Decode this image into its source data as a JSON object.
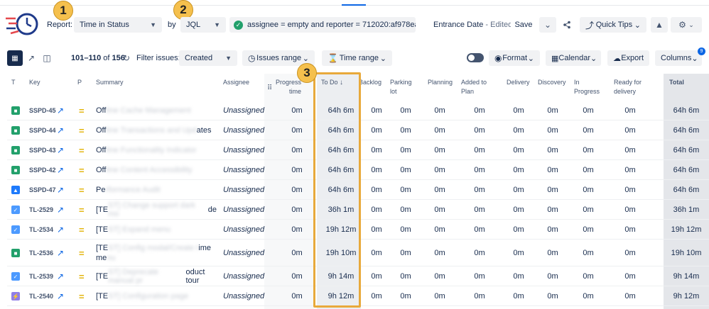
{
  "report_label": "Report:",
  "report_type": "Time in Status",
  "by_label": "by",
  "by_value": "JQL",
  "jql_query": "assignee = empty and reporter = 712020:af978ea3-8...",
  "entrance_date_title": "Entrance Date",
  "entrance_date_suffix": " - Edited",
  "save_label": "Save",
  "quick_tips_label": "Quick Tips",
  "badges": [
    "1",
    "2",
    "3"
  ],
  "toolbar": {
    "range": "101–110",
    "of": "of",
    "total": "156",
    "filter_label": "Filter issues:",
    "filter_value": "Created",
    "issues_range": "Issues range",
    "time_range": "Time range",
    "format": "Format",
    "calendar": "Calendar",
    "export": "Export",
    "columns": "Columns",
    "columns_badge": "9"
  },
  "headers": {
    "t": "T",
    "key": "Key",
    "p": "P",
    "summary": "Summary",
    "assignee": "Assignee",
    "progress": "Progress time",
    "todo": "To Do",
    "backlog": "Backlog",
    "parking": "Parking lot",
    "planning": "Planning",
    "added": "Added to Plan",
    "delivery": "Delivery",
    "discovery": "Discovery",
    "in_progress": "In Progress",
    "ready": "Ready for delivery",
    "total": "Total"
  },
  "rows": [
    {
      "type": "story",
      "key": "SSPD-45",
      "summary_prefix": "Off",
      "summary_blur": "line Cache Management",
      "summary_suffix": "",
      "assignee": "Unassigned",
      "progress": "0m",
      "todo": "64h 6m",
      "backlog": "0m",
      "parking": "0m",
      "planning": "0m",
      "added": "0m",
      "delivery": "0m",
      "discovery": "0m",
      "in_progress": "0m",
      "ready": "0m",
      "total": "64h 6m"
    },
    {
      "type": "story",
      "key": "SSPD-44",
      "summary_prefix": "Off",
      "summary_blur": "line Transactions and Upd",
      "summary_suffix": "ates",
      "assignee": "Unassigned",
      "progress": "0m",
      "todo": "64h 6m",
      "backlog": "0m",
      "parking": "0m",
      "planning": "0m",
      "added": "0m",
      "delivery": "0m",
      "discovery": "0m",
      "in_progress": "0m",
      "ready": "0m",
      "total": "64h 6m"
    },
    {
      "type": "story",
      "key": "SSPD-43",
      "summary_prefix": "Off",
      "summary_blur": "line Functionality Indicator",
      "summary_suffix": "",
      "assignee": "Unassigned",
      "progress": "0m",
      "todo": "64h 6m",
      "backlog": "0m",
      "parking": "0m",
      "planning": "0m",
      "added": "0m",
      "delivery": "0m",
      "discovery": "0m",
      "in_progress": "0m",
      "ready": "0m",
      "total": "64h 6m"
    },
    {
      "type": "story",
      "key": "SSPD-42",
      "summary_prefix": "Off",
      "summary_blur": "line Content Accessibility",
      "summary_suffix": "",
      "assignee": "Unassigned",
      "progress": "0m",
      "todo": "64h 6m",
      "backlog": "0m",
      "parking": "0m",
      "planning": "0m",
      "added": "0m",
      "delivery": "0m",
      "discovery": "0m",
      "in_progress": "0m",
      "ready": "0m",
      "total": "64h 6m"
    },
    {
      "type": "improvement",
      "key": "SSPD-47",
      "summary_prefix": "Pe",
      "summary_blur": "rformance Audit",
      "summary_suffix": "",
      "assignee": "Unassigned",
      "progress": "0m",
      "todo": "64h 6m",
      "backlog": "0m",
      "parking": "0m",
      "planning": "0m",
      "added": "0m",
      "delivery": "0m",
      "discovery": "0m",
      "in_progress": "0m",
      "ready": "0m",
      "total": "64h 6m"
    },
    {
      "type": "task",
      "key": "TL-2529",
      "summary_prefix": "[TE",
      "summary_blur": "ST] Change support dark mo",
      "summary_suffix": "de",
      "assignee": "Unassigned",
      "progress": "0m",
      "todo": "36h 1m",
      "backlog": "0m",
      "parking": "0m",
      "planning": "0m",
      "added": "0m",
      "delivery": "0m",
      "discovery": "0m",
      "in_progress": "0m",
      "ready": "0m",
      "total": "36h 1m"
    },
    {
      "type": "task",
      "key": "TL-2534",
      "summary_prefix": "[TE",
      "summary_blur": "ST] Expand menu",
      "summary_suffix": "",
      "assignee": "Unassigned",
      "progress": "0m",
      "todo": "19h 12m",
      "backlog": "0m",
      "parking": "0m",
      "planning": "0m",
      "added": "0m",
      "delivery": "0m",
      "discovery": "0m",
      "in_progress": "0m",
      "ready": "0m",
      "total": "19h 12m"
    },
    {
      "type": "story",
      "key": "TL-2536",
      "summary_prefix": "[TE",
      "summary_blur": "ST] Config modal/Create t",
      "summary_suffix": "ime",
      "summary_line2_prefix": "me",
      "summary_line2_blur": "nu",
      "assignee": "Unassigned",
      "progress": "0m",
      "todo": "19h 10m",
      "backlog": "0m",
      "parking": "0m",
      "planning": "0m",
      "added": "0m",
      "delivery": "0m",
      "discovery": "0m",
      "in_progress": "0m",
      "ready": "0m",
      "total": "19h 10m"
    },
    {
      "type": "task",
      "key": "TL-2539",
      "summary_prefix": "[TE",
      "summary_blur": "ST] Deprecate manual pr",
      "summary_suffix": "oduct tour",
      "assignee": "Unassigned",
      "progress": "0m",
      "todo": "9h 14m",
      "backlog": "0m",
      "parking": "0m",
      "planning": "0m",
      "added": "0m",
      "delivery": "0m",
      "discovery": "0m",
      "in_progress": "0m",
      "ready": "0m",
      "total": "9h 14m"
    },
    {
      "type": "epic",
      "key": "TL-2540",
      "summary_prefix": "[TE",
      "summary_blur": "ST] Configuration page",
      "summary_suffix": "",
      "assignee": "Unassigned",
      "progress": "0m",
      "todo": "9h 12m",
      "backlog": "0m",
      "parking": "0m",
      "planning": "0m",
      "added": "0m",
      "delivery": "0m",
      "discovery": "0m",
      "in_progress": "0m",
      "ready": "0m",
      "total": "9h 12m"
    }
  ],
  "colors": {
    "story": "#22a06b",
    "improvement": "#1d7afc",
    "task": "#4c9aff",
    "epic": "#8f7ee7",
    "priority": "#e2b203",
    "highlight": "#e8a93b",
    "accent": "#0c66e4"
  }
}
